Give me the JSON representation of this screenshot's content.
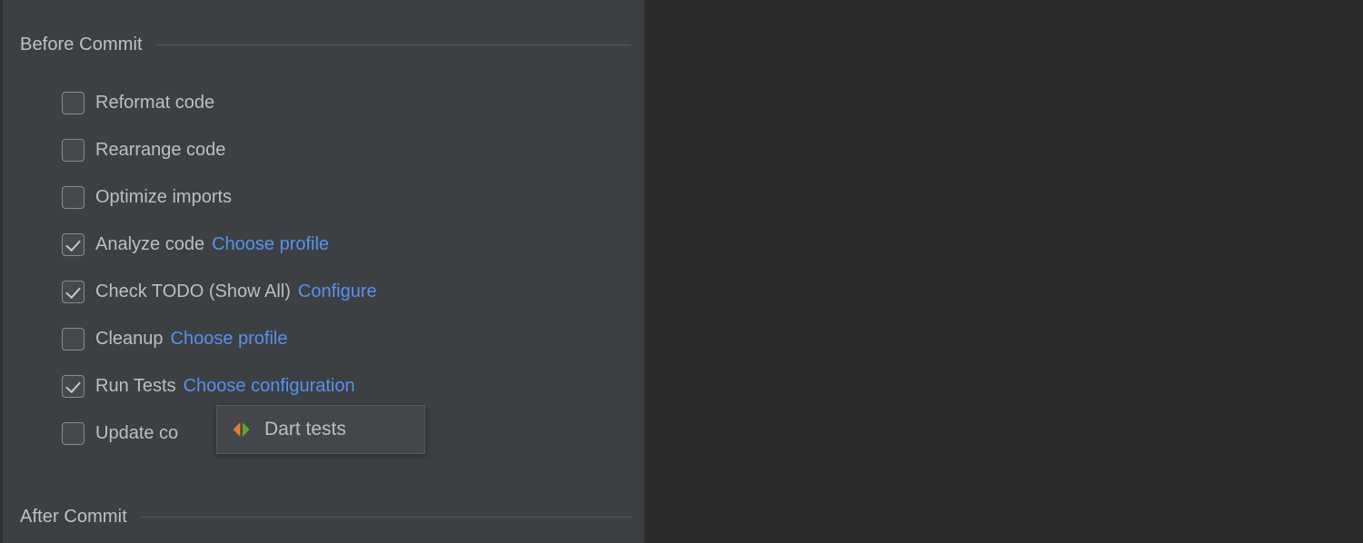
{
  "theme": {
    "panel_bg": "#3c4042",
    "right_pane_bg": "#2b2b2b",
    "text_color": "#bcbfc1",
    "link_color": "#5692f0",
    "rule_color": "#55585a",
    "popup_bg": "#43474a",
    "popup_border": "#55595c",
    "dart_icon_left_color": "#f4792b",
    "dart_icon_right_color": "#5aa832"
  },
  "sections": {
    "before_commit": {
      "title": "Before Commit"
    },
    "after_commit": {
      "title": "After Commit"
    }
  },
  "options": [
    {
      "label": "Reformat code",
      "checked": false,
      "link": ""
    },
    {
      "label": "Rearrange code",
      "checked": false,
      "link": ""
    },
    {
      "label": "Optimize imports",
      "checked": false,
      "link": ""
    },
    {
      "label": "Analyze code",
      "checked": true,
      "link": "Choose profile"
    },
    {
      "label": "Check TODO (Show All)",
      "checked": true,
      "link": "Configure"
    },
    {
      "label": "Cleanup",
      "checked": false,
      "link": "Choose profile"
    },
    {
      "label": "Run Tests",
      "checked": true,
      "link": "Choose configuration"
    },
    {
      "label": "Update co",
      "checked": false,
      "link": ""
    }
  ],
  "popup": {
    "icon": "dart-run-icon",
    "label": "Dart tests"
  }
}
